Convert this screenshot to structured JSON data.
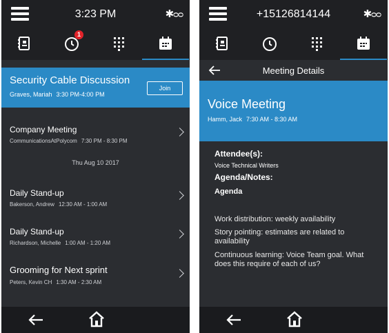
{
  "left_screen": {
    "time": "3:23 PM",
    "missed_calls_badge": "1",
    "active_meeting": {
      "title": "Security Cable Discussion",
      "organizer": "Graves, Mariah",
      "time": "3:30 PM-4:00 PM",
      "join_label": "Join"
    },
    "meetings_today": [
      {
        "title": "Company Meeting",
        "organizer": "CommunicationsAtPolycom",
        "time": "7:30 PM - 8:30 PM"
      }
    ],
    "date_separator": "Thu Aug 10 2017",
    "meetings_next": [
      {
        "title": "Daily Stand-up",
        "organizer": "Bakerson, Andrew",
        "time": "12:30 AM - 1:00 AM"
      },
      {
        "title": "Daily Stand-up",
        "organizer": "Richardson, Michelle",
        "time": "1:00 AM - 1:20 AM"
      },
      {
        "title": "Grooming for Next sprint",
        "organizer": "Peters, Kevin CH",
        "time": "1:30 AM - 2:30 AM"
      }
    ]
  },
  "right_screen": {
    "phone_number": "+15126814144",
    "header_title": "Meeting Details",
    "meeting": {
      "title": "Voice Meeting",
      "organizer": "Hamm, Jack",
      "time": "7:30 AM - 8:30 AM"
    },
    "attendees_label": "Attendee(s):",
    "attendees_value": "Voice Technical Writers",
    "agenda_notes_label": "Agenda/Notes:",
    "agenda_heading": "Agenda",
    "notes": [
      "Work distribution: weekly availability",
      "Story pointing: estimates are related to availability",
      "Continuous learning: Voice Team goal. What does this require of each of us?"
    ]
  },
  "colors": {
    "accent": "#2b8ac6",
    "background": "#2b2d31",
    "bar": "#1f2023",
    "badge": "#e2232a"
  },
  "icons": [
    "menu-icon",
    "bluetooth-icon",
    "voicemail-icon",
    "contacts-icon",
    "recents-icon",
    "dialpad-icon",
    "calendar-icon",
    "back-arrow-icon",
    "home-icon",
    "chevron-right-icon"
  ]
}
